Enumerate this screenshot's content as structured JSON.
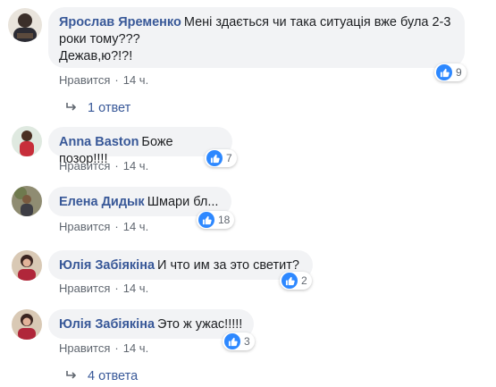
{
  "comments": [
    {
      "author": "Ярослав Яременко",
      "text": "Мені здається чи така ситуація вже була 2-3\nроки тому???\nДежав,ю?!?!",
      "reaction_count": "9",
      "like_label": "Нравится",
      "separator": "·",
      "time": "14 ч."
    },
    {
      "author": "Anna Baston",
      "text": "Боже позор!!!!",
      "reaction_count": "7",
      "like_label": "Нравится",
      "separator": "·",
      "time": "14 ч."
    },
    {
      "author": "Елена Дидык",
      "text": "Шмари бл...",
      "reaction_count": "18",
      "like_label": "Нравится",
      "separator": "·",
      "time": "14 ч."
    },
    {
      "author": "Юлія Забіякіна",
      "text": "И что им за это светит?",
      "reaction_count": "2",
      "like_label": "Нравится",
      "separator": "·",
      "time": "14 ч."
    },
    {
      "author": "Юлія Забіякіна",
      "text": "Это ж ужас!!!!!",
      "reaction_count": "3",
      "like_label": "Нравится",
      "separator": "·",
      "time": "14 ч."
    }
  ],
  "reply_threads": [
    {
      "label": "1 ответ"
    },
    {
      "label": "4 ответа"
    }
  ],
  "colors": {
    "author_link": "#385898",
    "bubble_bg": "#f2f3f5",
    "like_icon": "#2d88ff",
    "meta_text": "#606770"
  },
  "icons": [
    "like-icon",
    "reply-arrow-icon"
  ]
}
